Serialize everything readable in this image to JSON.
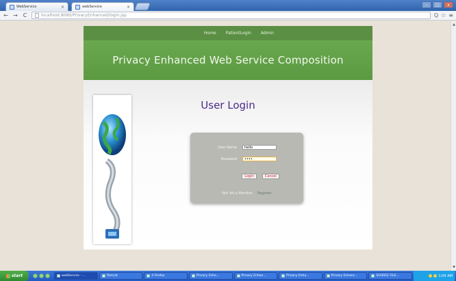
{
  "browser": {
    "tabs": [
      {
        "label": "WebService",
        "active": false
      },
      {
        "label": "webService",
        "active": true
      }
    ],
    "address": "localhost:8080/PrivacyEnhanced/login.jsp",
    "nav": {
      "back": "←",
      "forward": "→",
      "reload": "C"
    },
    "right_icons": {
      "zoom": "Q",
      "star": "☆",
      "menu": "≡"
    },
    "window_controls": {
      "min": "–",
      "max": "□",
      "close": "x"
    }
  },
  "site": {
    "nav_items": [
      "Home",
      "PatientLogin",
      "Admin"
    ],
    "banner_title": "Privacy Enhanced Web Service Composition",
    "login": {
      "title": "User Login",
      "username_label": "User Name",
      "username_value": "hello",
      "password_label": "Password",
      "password_value": "....",
      "login_button": "Login",
      "cancel_button": "Cancel",
      "new_user_text": "Not Yet a Member",
      "register_link": "Register"
    }
  },
  "taskbar": {
    "start_label": "start",
    "tasks": [
      "webService - ...",
      "Tomcat",
      "4 Firefox",
      "Privacy Enha...",
      "Privacy Enhan...",
      "Privacy Enha...",
      "Privacy Enhanc...",
      "SOURCE FILE..."
    ],
    "clock": "1:04 AM"
  },
  "colors": {
    "nav_green": "#5b8f44",
    "banner_green": "#6aa84f",
    "title_purple": "#4a2a8a",
    "login_box": "#b9b9b4",
    "taskbar_blue": "#245ac2"
  }
}
